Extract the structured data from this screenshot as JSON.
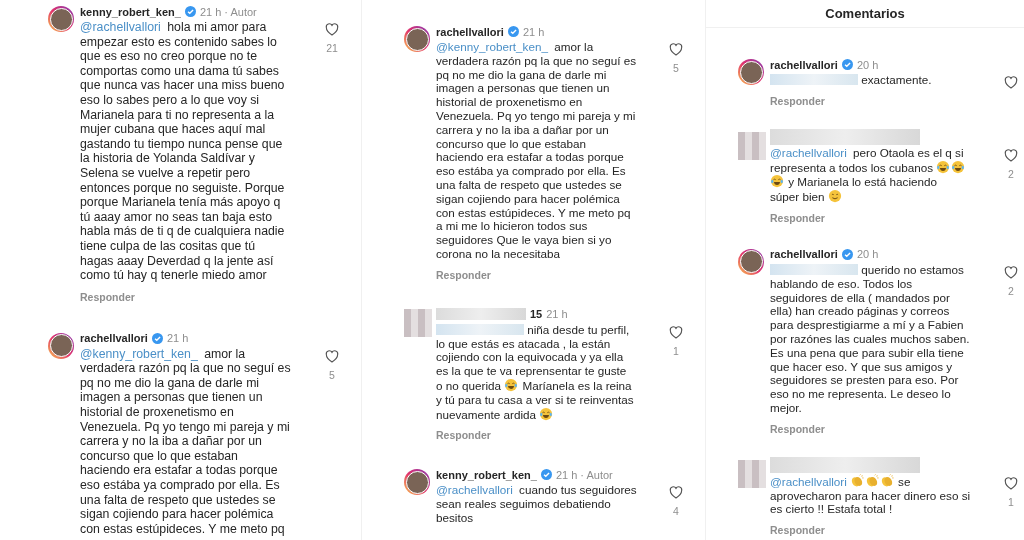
{
  "panels": [
    {
      "comments": [
        {
          "kind": "story-avatar",
          "author": {
            "name": "kenny_robert_ken_",
            "verified": true,
            "time": "21 h · Autor"
          },
          "body": [
            {
              "kind": "mention",
              "text": "@rachellvallori"
            },
            {
              "kind": "text",
              "text": "  hola mi amor  para\nempezar esto es contenido sabes lo\nque es eso no creo porque no te\ncomportas como una dama tú sabes\nque nunca vas hacer una miss bueno\neso lo sabes pero a lo que voy si\nMarianela para ti no representa a la\nmujer cubana que haces aquí mal\ngastando tu tiempo nunca pense que\nla historia de Yolanda Saldívar y\nSelena  se vuelve a repetir  pero\nentonces porque no seguiste. Porque\nporque Marianela tenía más apoyo q\ntú aaay amor no seas tan baja esto\nhabla más de ti q de cualquiera nadie\ntiene culpa de las cositas que tú\nhagas aaay Deverdad q la jente así\ncomo tú hay q tenerle miedo  amor"
            }
          ],
          "likes": "21",
          "reply": "Responder"
        },
        {
          "kind": "story-avatar",
          "author": {
            "name": "rachellvallori",
            "verified": true,
            "time": "21 h"
          },
          "body": [
            {
              "kind": "mention",
              "text": "@kenny_robert_ken_"
            },
            {
              "kind": "text",
              "text": " amor la\nverdadera razón pq la que no seguí es\npq no me dio la gana de darle mi\nimagen a personas que tienen un\nhistorial de proxenetismo en\nVenezuela. Pq yo tengo mi pareja y mi\ncarrera y no la iba a dañar por un\nconcurso que lo que estaban\nhaciendo era estafar a todas porque\neso estába ya comprado por ella.  Es\nuna falta de respeto que ustedes se\nsigan cojiendo para hacer polémica\ncon estas estúpideces. Y me meto pq"
            }
          ],
          "likes": "5"
        }
      ]
    },
    {
      "comments": [
        {
          "kind": "story-avatar",
          "author": {
            "name": "rachellvallori",
            "verified": true,
            "time": "21 h"
          },
          "body": [
            {
              "kind": "mention",
              "text": "@kenny_robert_ken_"
            },
            {
              "kind": "text",
              "text": " amor la\nverdadera razón pq la que no seguí es\npq no me dio la gana de darle mi\nimagen a personas que tienen un\nhistorial de proxenetismo en\nVenezuela. Pq yo tengo mi pareja y mi\ncarrera y no la iba a dañar por un\nconcurso que lo que estaban\nhaciendo era estafar a todas porque\neso estába ya comprado por ella.  Es\nuna falta de respeto que ustedes se\nsigan cojiendo para hacer polémica\ncon estas estúpideces. Y me meto pq\na mi me lo hicieron todos sus\nseguidores  Que le vaya bien si yo\ncorona no la necesitaba"
            }
          ],
          "likes": "5",
          "reply": "Responder"
        },
        {
          "kind": "blurred",
          "author": {
            "name": "15",
            "verified": false,
            "time": "21 h"
          },
          "body": [
            {
              "kind": "blurred"
            },
            {
              "kind": "text",
              "text": " niña desde tu perfil,\nlo que estás es atacada , la están\ncojiendo con la equivocada y ya ella\nes la que te va reprensentar te guste\no no querida "
            },
            {
              "kind": "laughing-emoji"
            },
            {
              "kind": "text",
              "text": " Maríanela es la reina\ny tú para tu casa a ver si te reinventas\nnuevamente ardida "
            },
            {
              "kind": "laughing-emoji"
            }
          ],
          "likes": "1",
          "reply": "Responder"
        },
        {
          "kind": "story-avatar",
          "author": {
            "name": "kenny_robert_ken_",
            "verified": true,
            "time": "21 h · Autor"
          },
          "body": [
            {
              "kind": "mention",
              "text": "@rachellvallori"
            },
            {
              "kind": "text",
              "text": " cuando tus seguidores\nsean reales seguimos debatiendo\nbesitos"
            }
          ],
          "likes": "4"
        }
      ]
    },
    {
      "header": "Comentarios",
      "comments": [
        {
          "kind": "story-avatar",
          "author": {
            "name": "rachellvallori",
            "verified": true,
            "time": "20 h"
          },
          "body": [
            {
              "kind": "blurred"
            },
            {
              "kind": "text",
              "text": " exactamente."
            }
          ],
          "reply": "Responder"
        },
        {
          "kind": "blurred",
          "body": [
            {
              "kind": "mention",
              "text": "@rachellvallori"
            },
            {
              "kind": "text",
              "text": " pero Otaola es el q si\nrepresenta a todos los cubanos "
            },
            {
              "kind": "laughing-emoji"
            },
            {
              "kind": "laughing-emoji"
            },
            {
              "kind": "line-break"
            },
            {
              "kind": "laughing-emoji"
            },
            {
              "kind": "text",
              "text": " y Marianela lo está haciendo\nsúper bien "
            },
            {
              "kind": "smiling-emoji"
            }
          ],
          "likes": "2",
          "reply": "Responder"
        },
        {
          "kind": "story-avatar",
          "author": {
            "name": "rachellvallori",
            "verified": true,
            "time": "20 h"
          },
          "body": [
            {
              "kind": "blurred"
            },
            {
              "kind": "text",
              "text": " querido no estamos\nhablando de eso.  Todos los\nseguidores de ella ( mandados por\nella) han creado páginas y correos\npara desprestigiarme a mí y a Fabien\npor razónes las cuales muchos saben.\nEs una pena que para subir ella tiene\nque hacer eso.  Y que sus amigos y\nseguidores se presten para eso. Por\neso no me representa. Le deseo lo\nmejor."
            }
          ],
          "likes": "2",
          "reply": "Responder"
        },
        {
          "kind": "blurred",
          "body": [
            {
              "kind": "mention",
              "text": "@rachellvallori"
            },
            {
              "kind": "clapping-emoji"
            },
            {
              "kind": "clapping-emoji"
            },
            {
              "kind": "clapping-emoji"
            },
            {
              "kind": "text",
              "text": " se\naprovecharon para hacer dinero eso si\nes cierto !! Estafa total !"
            }
          ],
          "likes": "1",
          "reply": "Responder"
        }
      ]
    }
  ]
}
